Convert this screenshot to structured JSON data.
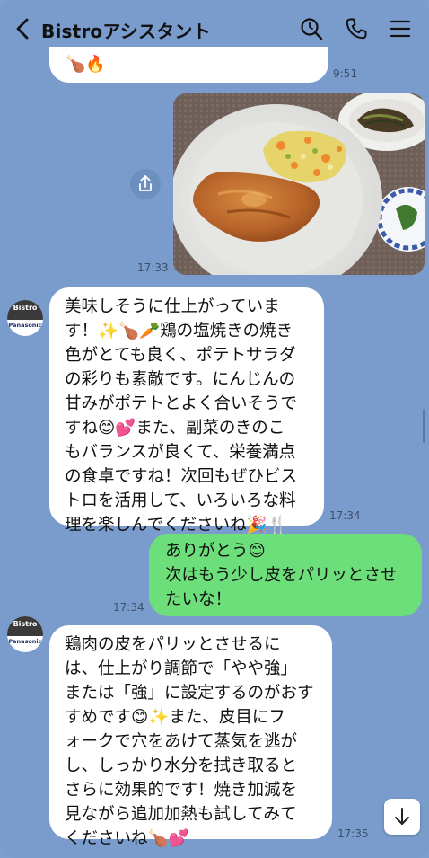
{
  "header": {
    "title": "Bistroアシスタント"
  },
  "messages": [
    {
      "id": "m0",
      "text": "🍗🔥",
      "time": "9:51"
    },
    {
      "id": "photo",
      "time": "17:33"
    },
    {
      "id": "m1",
      "text": "美味しそうに仕上がっていま\nす！✨🍗🥕鶏の塩焼きの焼き\n色がとても良く、ポテトサラダ\nの彩りも素敵です。にんじんの\n甘みがポテトとよく合いそうで\nすね😊💕また、副菜のきのこ\nもバランスが良くて、栄養満点\nの食卓ですね！次回もぜひビス\nトロを活用して、いろいろな料\n理を楽しんでくださいね🎉🍴",
      "time": "17:34"
    },
    {
      "id": "m2",
      "text": "ありがとう😊\n次はもう少し皮をパリッとさせ\nたいな！",
      "time": "17:34"
    },
    {
      "id": "m3",
      "text": "鶏肉の皮をパリッとさせるに\nは、仕上がり調節で「やや強」\nまたは「強」に設定するのがおす\nすめです😊✨また、皮目にフ\nォークで穴をあけて蒸気を逃が\nし、しっかり水分を拭き取ると\nさらに効果的です！焼き加減を\n見ながら追加加熱も試してみて\nくださいね🍗💕",
      "time": "17:35"
    }
  ],
  "avatar": {
    "line1": "Bistro",
    "line2": "Panasonic"
  },
  "colors": {
    "background": "#7a9ccd",
    "user_bubble": "#6cdf7b",
    "bot_bubble": "#ffffff"
  }
}
